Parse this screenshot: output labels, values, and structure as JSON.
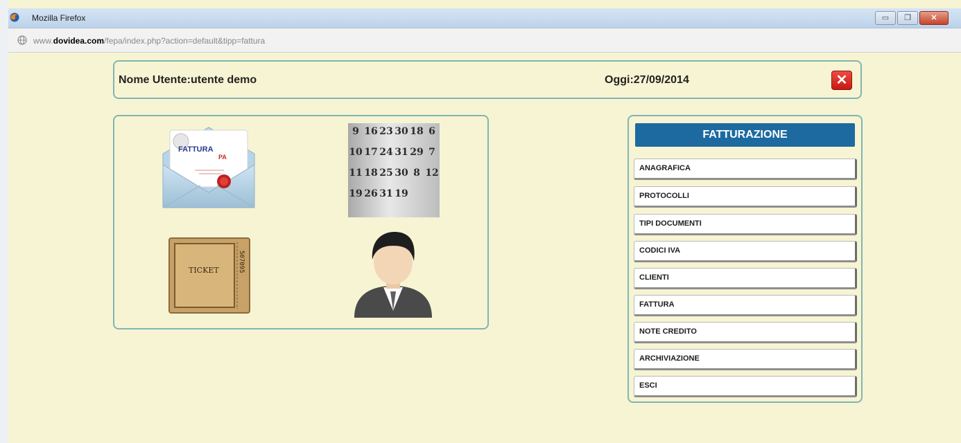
{
  "window": {
    "title": "Mozilla Firefox",
    "minimize_label": "▭",
    "restore_label": "❐",
    "close_label": "✕"
  },
  "address_bar": {
    "url_prefix": "www.",
    "url_domain": "dovidea.com",
    "url_path": "/fepa/index.php?action=default&tipp=fattura"
  },
  "header": {
    "user": "Nome Utente:utente demo",
    "date": "Oggi:27/09/2014",
    "close_symbol": "✕"
  },
  "tiles": {
    "fattura_word": "FATTURA",
    "fattura_pa": "PA",
    "ticket_word": "TICKET",
    "ticket_number": "507095",
    "calendar_numbers": [
      "9",
      "16",
      "23",
      "30",
      "18",
      "6",
      "10",
      "17",
      "24",
      "31",
      "29",
      "7",
      "11",
      "18",
      "25",
      "30",
      "8",
      "12",
      "19",
      "26",
      "31",
      "19"
    ]
  },
  "menu": {
    "title": "FATTURAZIONE",
    "items": [
      "ANAGRAFICA",
      "PROTOCOLLI",
      "TIPI DOCUMENTI",
      "CODICI IVA",
      "CLIENTI",
      "FATTURA",
      "NOTE CREDITO",
      "ARCHIVIAZIONE",
      "ESCI"
    ]
  },
  "colors": {
    "page_bg": "#f7f4d3",
    "panel_border": "#7fb6b1",
    "menu_header": "#1d6aa1",
    "close_red": "#d8261e"
  }
}
